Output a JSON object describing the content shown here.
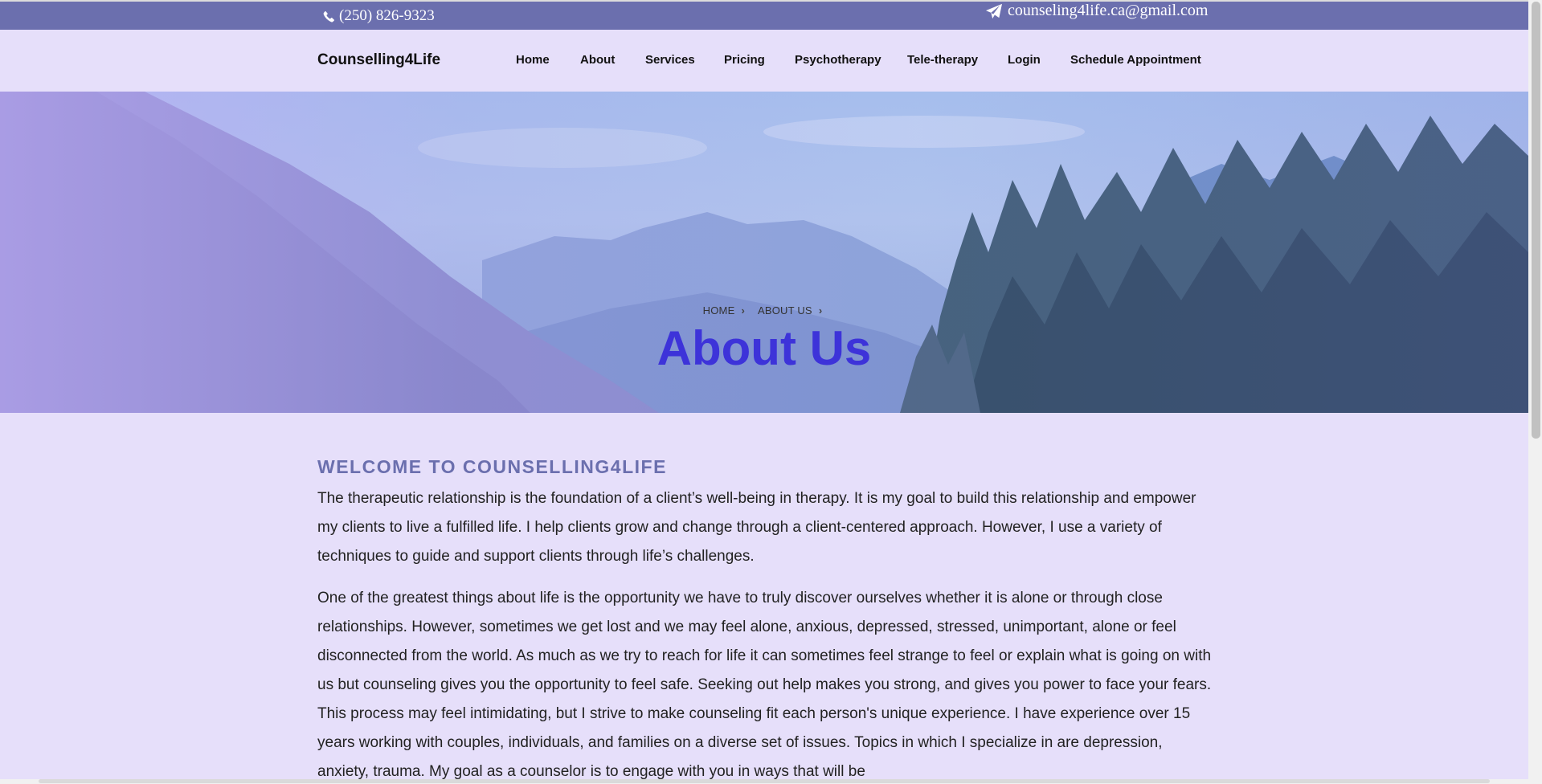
{
  "topbar": {
    "phone": "(250) 826-9323",
    "email": "counseling4life.ca@gmail.com",
    "phone_icon": "phone-icon",
    "email_icon": "paper-plane-icon"
  },
  "navbar": {
    "brand": "Counselling4Life",
    "items": [
      {
        "label": "Home"
      },
      {
        "label": "About"
      },
      {
        "label": "Services"
      },
      {
        "label": "Pricing"
      },
      {
        "label": "Psychotherapy"
      },
      {
        "label": "Tele-therapy"
      },
      {
        "label": "Login"
      },
      {
        "label": "Schedule Appointment"
      }
    ]
  },
  "hero": {
    "breadcrumb": [
      "HOME",
      "ABOUT US"
    ],
    "title": "About Us"
  },
  "content": {
    "heading": "WELCOME TO COUNSELLING4LIFE",
    "paragraphs": [
      "The therapeutic relationship is the foundation of a client’s well-being in therapy. It is my goal to build this relationship and empower my clients to live a fulfilled life. I help clients grow and change through a client-centered approach. However, I use a variety of techniques to guide and support clients through life’s challenges.",
      "One of the greatest things about life is the opportunity we have to truly discover ourselves whether it is alone or through close relationships. However, sometimes we get lost and we may feel alone, anxious, depressed, stressed, unimportant, alone or feel disconnected from the world. As much as we try to reach for life it can sometimes feel strange to feel or explain what is going on with us but counseling gives you the opportunity to feel safe. Seeking out help makes you strong, and gives you power to face your fears. This process may feel intimidating, but I strive to make counseling fit each person's unique experience. I have experience over 15 years working with couples, individuals, and families on a diverse set of issues. Topics in which I specialize in are depression, anxiety, trauma. My goal as a counselor is to engage with you in ways that will be"
    ]
  },
  "colors": {
    "topbar": "#6b6fae",
    "page_bg": "#e6dffa",
    "title": "#3d33d9",
    "heading": "#6b6fae"
  }
}
